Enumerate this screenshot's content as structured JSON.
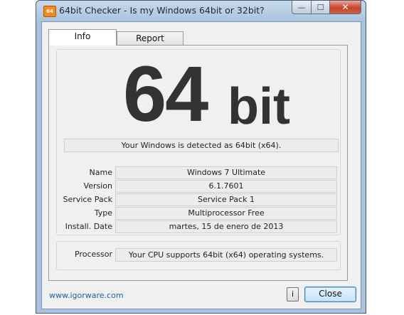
{
  "window": {
    "title": "64bit Checker - Is my Windows 64bit or 32bit?",
    "icon_text": "64",
    "buttons": {
      "minimize": "—",
      "maximize": "☐",
      "close": "✕"
    }
  },
  "tabs": [
    {
      "label": "Info",
      "active": true
    },
    {
      "label": "Report",
      "active": false
    }
  ],
  "result": {
    "number": "64",
    "unit": "bit",
    "detected_text": "Your Windows is detected as 64bit (x64)."
  },
  "system_info": [
    {
      "label": "Name",
      "value": "Windows 7 Ultimate"
    },
    {
      "label": "Version",
      "value": "6.1.7601"
    },
    {
      "label": "Service Pack",
      "value": "Service Pack 1"
    },
    {
      "label": "Type",
      "value": "Multiprocessor Free"
    },
    {
      "label": "Install. Date",
      "value": "martes, 15 de enero de 2013"
    }
  ],
  "processor": {
    "label": "Processor",
    "value": "Your CPU supports 64bit (x64) operating systems."
  },
  "footer": {
    "link": "www.igorware.com",
    "info_button": "i",
    "close_button": "Close"
  },
  "colors": {
    "link": "#1f5fa0",
    "big_text": "#333333",
    "close_button_border": "#3c7fb1"
  }
}
